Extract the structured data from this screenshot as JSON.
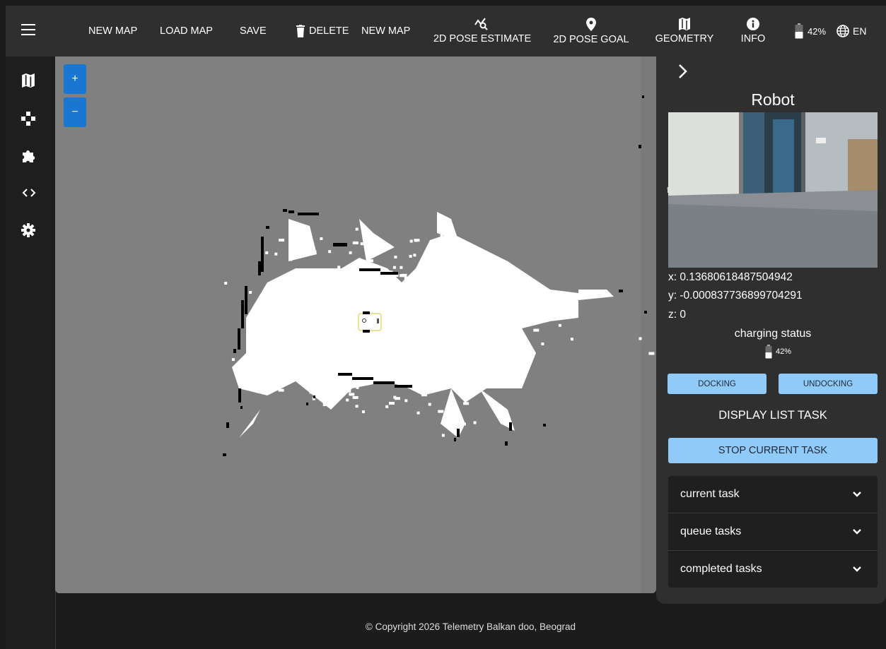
{
  "toolbar": {
    "new_map": "NEW MAP",
    "load_map": "LOAD MAP",
    "save": "SAVE",
    "delete": "DELETE",
    "new_map_2": "NEW MAP",
    "pose_estimate": "2D POSE ESTIMATE",
    "pose_goal": "2D POSE GOAL",
    "geometry": "GEOMETRY",
    "info": "INFO",
    "battery": "42%",
    "language": "EN"
  },
  "sidebar": {
    "items": [
      {
        "icon": "map-icon"
      },
      {
        "icon": "gamepad-icon"
      },
      {
        "icon": "puzzle-icon"
      },
      {
        "icon": "code-icon"
      },
      {
        "icon": "gear-icon"
      }
    ]
  },
  "map": {
    "zoom_in": "+",
    "zoom_out": "−"
  },
  "panel": {
    "title": "Robot",
    "camera_label": "f",
    "x": "x: 0.13680618487504942",
    "y": "y: -0.000837736899704291",
    "z": "z: 0",
    "charging_label": "charging status",
    "charging_value": "42%",
    "docking": "DOCKING",
    "undocking": "UNDOCKING",
    "display_list": "DISPLAY LIST TASK",
    "stop_task": "STOP CURRENT TASK",
    "tasks": [
      "current task",
      "queue tasks",
      "completed tasks"
    ]
  },
  "footer": "© Copyright 2026 Telemetry Balkan doo, Beograd",
  "colors": {
    "accent": "#90caf9",
    "zoom": "#1976d2",
    "topbar": "#2f2f2f",
    "map_bg": "#808080"
  }
}
